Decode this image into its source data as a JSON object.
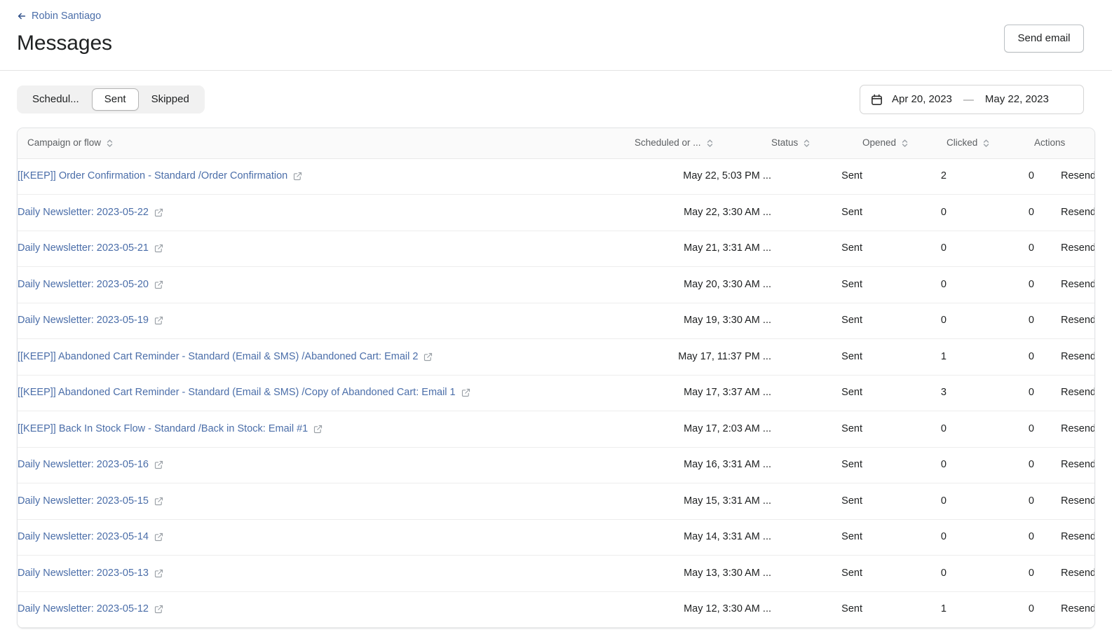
{
  "header": {
    "breadcrumb_label": "Robin Santiago",
    "back_icon": "arrow-left-icon",
    "title": "Messages",
    "send_email_label": "Send email"
  },
  "filters": {
    "tabs": [
      {
        "label": "Schedul...",
        "selected": false
      },
      {
        "label": "Sent",
        "selected": true
      },
      {
        "label": "Skipped",
        "selected": false
      }
    ],
    "date_range": {
      "icon": "calendar-icon",
      "start": "Apr 20, 2023",
      "separator": "—",
      "end": "May 22, 2023"
    }
  },
  "table": {
    "columns": [
      {
        "key": "campaign",
        "label": "Campaign or flow",
        "sortable": true
      },
      {
        "key": "date",
        "label": "Scheduled or ...",
        "sortable": true
      },
      {
        "key": "status",
        "label": "Status",
        "sortable": true
      },
      {
        "key": "opened",
        "label": "Opened",
        "sortable": true
      },
      {
        "key": "clicked",
        "label": "Clicked",
        "sortable": true
      },
      {
        "key": "actions",
        "label": "Actions",
        "sortable": false
      }
    ],
    "rows": [
      {
        "campaign": "[[KEEP]] Order Confirmation - Standard /Order Confirmation",
        "date": "May 22, 5:03 PM ...",
        "status": "Sent",
        "opened": "2",
        "clicked": "0",
        "action": "Resend"
      },
      {
        "campaign": "Daily Newsletter: 2023-05-22",
        "date": "May 22, 3:30 AM ...",
        "status": "Sent",
        "opened": "0",
        "clicked": "0",
        "action": "Resend"
      },
      {
        "campaign": "Daily Newsletter: 2023-05-21",
        "date": "May 21, 3:31 AM ...",
        "status": "Sent",
        "opened": "0",
        "clicked": "0",
        "action": "Resend"
      },
      {
        "campaign": "Daily Newsletter: 2023-05-20",
        "date": "May 20, 3:30 AM ...",
        "status": "Sent",
        "opened": "0",
        "clicked": "0",
        "action": "Resend"
      },
      {
        "campaign": "Daily Newsletter: 2023-05-19",
        "date": "May 19, 3:30 AM ...",
        "status": "Sent",
        "opened": "0",
        "clicked": "0",
        "action": "Resend"
      },
      {
        "campaign": "[[KEEP]] Abandoned Cart Reminder - Standard (Email & SMS) /Abandoned Cart: Email 2",
        "date": "May 17, 11:37 PM ...",
        "status": "Sent",
        "opened": "1",
        "clicked": "0",
        "action": "Resend"
      },
      {
        "campaign": "[[KEEP]] Abandoned Cart Reminder - Standard (Email & SMS) /Copy of Abandoned Cart: Email 1",
        "date": "May 17, 3:37 AM ...",
        "status": "Sent",
        "opened": "3",
        "clicked": "0",
        "action": "Resend"
      },
      {
        "campaign": "[[KEEP]] Back In Stock Flow - Standard /Back in Stock: Email #1",
        "date": "May 17, 2:03 AM ...",
        "status": "Sent",
        "opened": "0",
        "clicked": "0",
        "action": "Resend"
      },
      {
        "campaign": "Daily Newsletter: 2023-05-16",
        "date": "May 16, 3:31 AM ...",
        "status": "Sent",
        "opened": "0",
        "clicked": "0",
        "action": "Resend"
      },
      {
        "campaign": "Daily Newsletter: 2023-05-15",
        "date": "May 15, 3:31 AM ...",
        "status": "Sent",
        "opened": "0",
        "clicked": "0",
        "action": "Resend"
      },
      {
        "campaign": "Daily Newsletter: 2023-05-14",
        "date": "May 14, 3:31 AM ...",
        "status": "Sent",
        "opened": "0",
        "clicked": "0",
        "action": "Resend"
      },
      {
        "campaign": "Daily Newsletter: 2023-05-13",
        "date": "May 13, 3:30 AM ...",
        "status": "Sent",
        "opened": "0",
        "clicked": "0",
        "action": "Resend"
      },
      {
        "campaign": "Daily Newsletter: 2023-05-12",
        "date": "May 12, 3:30 AM ...",
        "status": "Sent",
        "opened": "1",
        "clicked": "0",
        "action": "Resend"
      }
    ],
    "row_link_icon": "external-link-icon",
    "sort_icon": "sort-chevrons-icon"
  },
  "colors": {
    "link": "#4b6ea9",
    "text": "#202223",
    "muted": "#5c5f62",
    "border": "#e1e3e5",
    "header_bg": "#fafafa",
    "segment_bg": "#f1f1f1"
  }
}
